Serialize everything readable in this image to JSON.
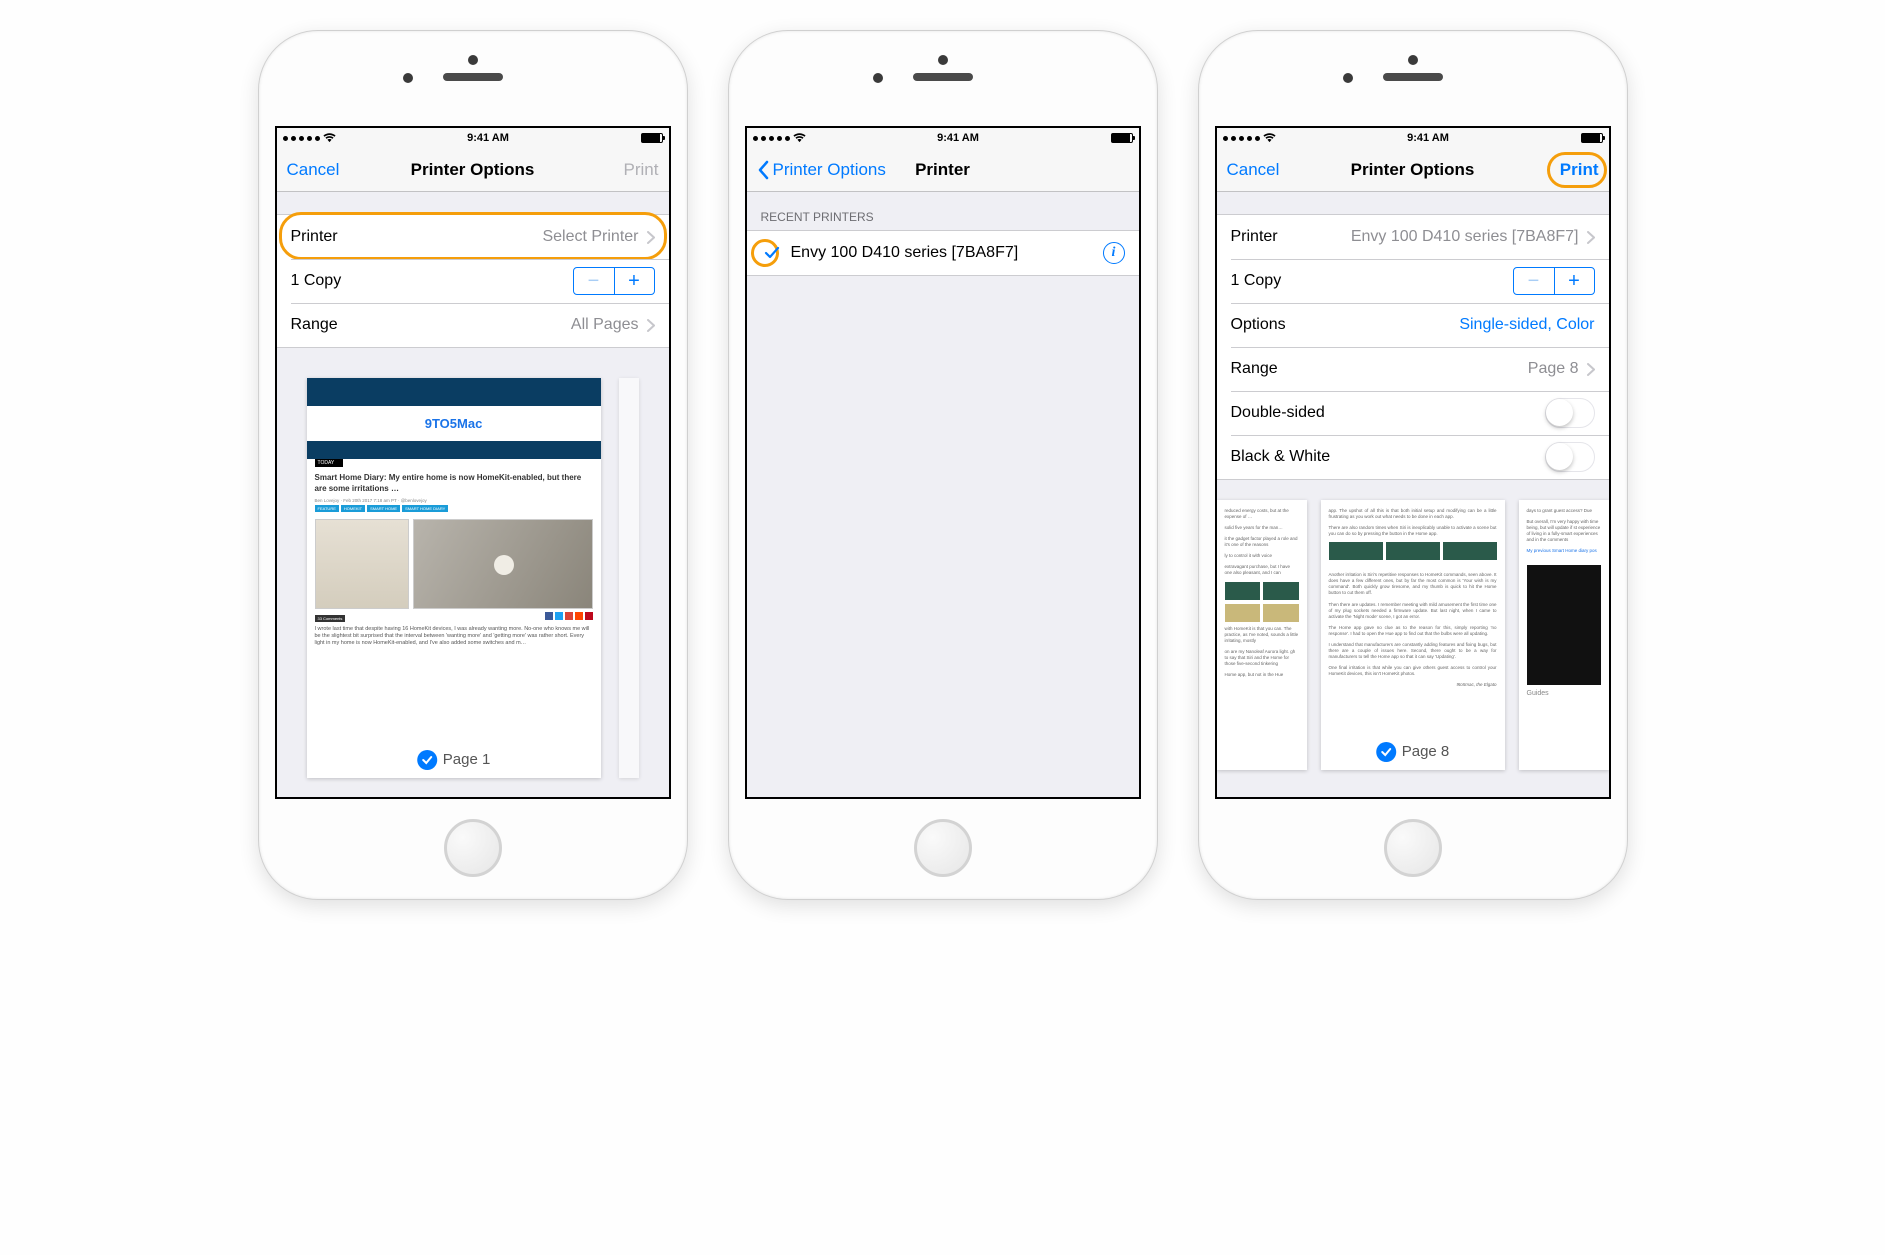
{
  "status_bar": {
    "time": "9:41 AM"
  },
  "phone1": {
    "nav": {
      "title": "Printer Options",
      "cancel": "Cancel",
      "print": "Print"
    },
    "rows": {
      "printer_label": "Printer",
      "printer_value": "Select Printer",
      "copies_label": "1 Copy",
      "range_label": "Range",
      "range_value": "All Pages"
    },
    "preview": {
      "page_label": "Page 1",
      "article_site": "9TO5Mac",
      "article_title": "Smart Home Diary: My entire home is now HomeKit-enabled, but there are some irritations …",
      "author_line": "Ben Lovejoy · Feb 20th 2017 7:18 am PT · @benlovejoy",
      "tags": [
        "FEATURE",
        "HOMEKIT",
        "SMART HOME",
        "SMART HOME DIARY"
      ],
      "comments_label": "33 Comments",
      "excerpt": "I wrote last time that despite having 16 HomeKit devices, I was already wanting more. No-one who knows me will be the slightest bit surprised that the interval between 'wanting more' and 'getting more' was rather short. Every light in my home is now HomeKit-enabled, and I've also added some switches and m…"
    }
  },
  "phone2": {
    "nav": {
      "back": "Printer Options",
      "title": "Printer"
    },
    "section_header": "RECENT PRINTERS",
    "printer_name": "Envy 100 D410 series [7BA8F7]"
  },
  "phone3": {
    "nav": {
      "title": "Printer Options",
      "cancel": "Cancel",
      "print": "Print"
    },
    "rows": {
      "printer_label": "Printer",
      "printer_value": "Envy 100 D410 series [7BA8F7]",
      "copies_label": "1 Copy",
      "options_label": "Options",
      "options_value": "Single-sided, Color",
      "range_label": "Range",
      "range_value": "Page 8",
      "double_sided_label": "Double-sided",
      "bw_label": "Black & White"
    },
    "preview": {
      "page_label": "Page 8",
      "guides_label": "Guides"
    }
  }
}
